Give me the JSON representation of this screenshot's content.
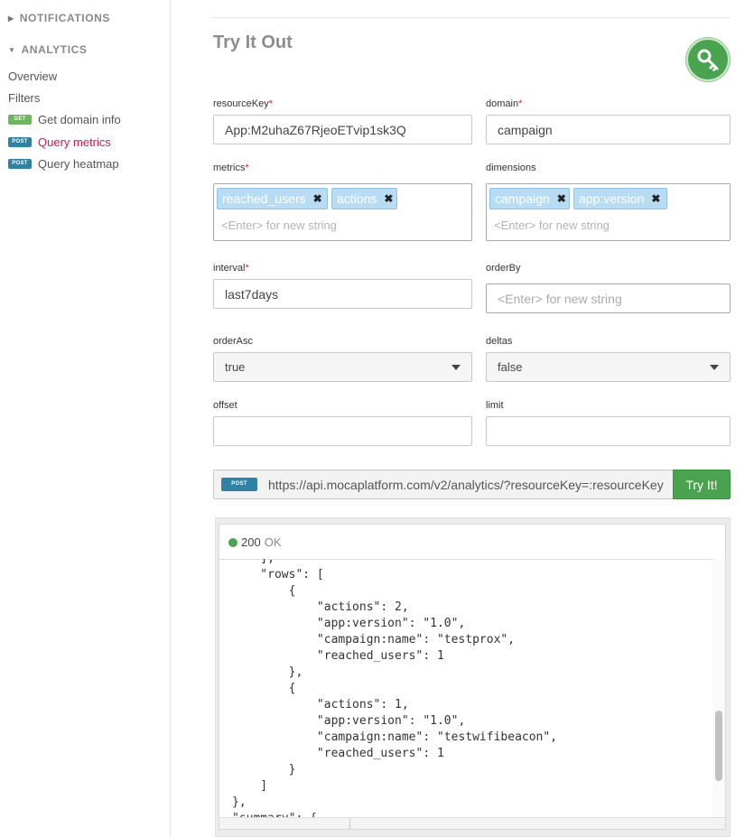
{
  "sidebar": {
    "sections": [
      {
        "label": "NOTIFICATIONS"
      },
      {
        "label": "ANALYTICS"
      }
    ],
    "items": [
      {
        "label": "Overview"
      },
      {
        "label": "Filters"
      },
      {
        "label": "Get domain info",
        "method": "GET"
      },
      {
        "label": "Query metrics",
        "method": "POST"
      },
      {
        "label": "Query heatmap",
        "method": "POST"
      }
    ]
  },
  "main": {
    "title": "Try It Out",
    "fields": {
      "resourceKey": {
        "label": "resourceKey",
        "required_mark": "*",
        "value": "App:M2uhaZ67RjeoETvip1sk3Q"
      },
      "domain": {
        "label": "domain",
        "required_mark": "*",
        "value": "campaign"
      },
      "metrics": {
        "label": "metrics",
        "required_mark": "*",
        "tags": [
          "reached_users",
          "actions"
        ],
        "placeholder": "<Enter> for new string"
      },
      "dimensions": {
        "label": "dimensions",
        "tags": [
          "campaign",
          "app:version"
        ],
        "placeholder": "<Enter> for new string"
      },
      "interval": {
        "label": "interval",
        "required_mark": "*",
        "value": "last7days"
      },
      "orderBy": {
        "label": "orderBy",
        "placeholder": "<Enter> for new string"
      },
      "orderAsc": {
        "label": "orderAsc",
        "value": "true"
      },
      "deltas": {
        "label": "deltas",
        "value": "false"
      },
      "offset": {
        "label": "offset",
        "value": ""
      },
      "limit": {
        "label": "limit",
        "value": ""
      }
    },
    "request": {
      "method": "POST",
      "url": "https://api.mocaplatform.com/v2/analytics/?resourceKey=:resourceKey",
      "button_label": "Try It!"
    },
    "response": {
      "status_code": "200",
      "status_text": "OK",
      "body": "    ],\n    \"rows\": [\n        {\n            \"actions\": 2,\n            \"app:version\": \"1.0\",\n            \"campaign:name\": \"testprox\",\n            \"reached_users\": 1\n        },\n        {\n            \"actions\": 1,\n            \"app:version\": \"1.0\",\n            \"campaign:name\": \"testwifibeacon\",\n            \"reached_users\": 1\n        }\n    ]\n},\n\"summary\": {"
    }
  },
  "colors": {
    "accent": "#d6164d",
    "green": "#4aa34f",
    "post": "#2e82a4",
    "get": "#69b85a",
    "tag": "#b9dcf5"
  },
  "icons": [
    "caret-right-icon",
    "caret-down-icon",
    "key-icon",
    "close-icon",
    "dropdown-arrow-icon"
  ]
}
